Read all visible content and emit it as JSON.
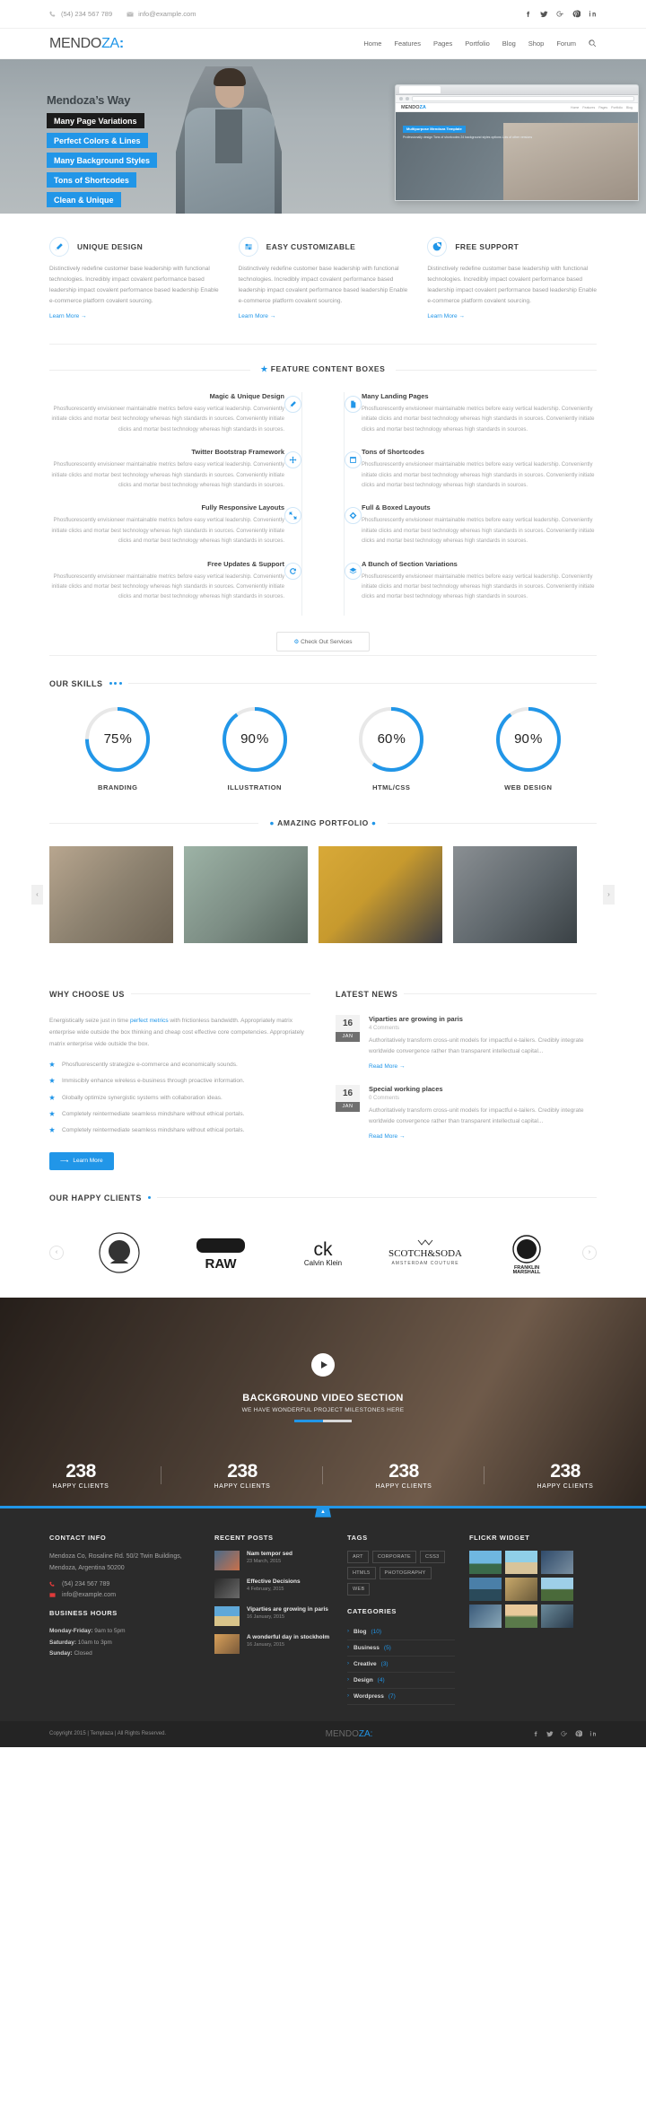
{
  "topbar": {
    "phone": "(54) 234 567 789",
    "email": "info@example.com",
    "social": [
      "facebook-icon",
      "twitter-icon",
      "google-plus-icon",
      "pinterest-icon",
      "linkedin-icon"
    ]
  },
  "header": {
    "logo_a": "MENDO",
    "logo_b": "ZA",
    "logo_dots": ":",
    "nav": [
      "Home",
      "Features",
      "Pages",
      "Portfolio",
      "Blog",
      "Shop",
      "Forum"
    ],
    "search_icon": "search-icon"
  },
  "hero": {
    "title": "Mendoza’s Way",
    "captions": [
      {
        "text": "Many Page Variations",
        "style": "dark"
      },
      {
        "text": "Perfect Colors & Lines",
        "style": "blue"
      },
      {
        "text": "Many Background Styles",
        "style": "blue"
      },
      {
        "text": "Tons of Shortcodes",
        "style": "blue"
      },
      {
        "text": "Clean & Unique",
        "style": "blue"
      }
    ],
    "browser": {
      "logo_a": "MENDO",
      "logo_b": "ZA",
      "menu": [
        "Home",
        "Features",
        "Pages",
        "Portfolio",
        "Blog"
      ],
      "badge": "Multipurpose Mendoza Template",
      "sub": "Professionally design\nTons of shortcodes\n24 background styles options\nLots of other versions"
    }
  },
  "features3": [
    {
      "icon": "magic-wand-icon",
      "title": "UNIQUE DESIGN",
      "body": "Distinctively redefine customer base leadership with functional technologies. Incredibly impact covalent performance based leadership impact covalent performance based leadership Enable e-commerce platform covalent sourcing.",
      "link": "Learn More →"
    },
    {
      "icon": "sliders-icon",
      "title": "EASY CUSTOMIZABLE",
      "body": "Distinctively redefine customer base leadership with functional technologies. Incredibly impact covalent performance based leadership impact covalent performance based leadership Enable e-commerce platform covalent sourcing.",
      "link": "Learn More →"
    },
    {
      "icon": "lifebuoy-icon",
      "title": "FREE SUPPORT",
      "body": "Distinctively redefine customer base leadership with functional technologies. Incredibly impact covalent performance based leadership impact covalent performance based leadership Enable e-commerce platform covalent sourcing.",
      "link": "Learn More →"
    }
  ],
  "fcb": {
    "heading_prefix": "★",
    "heading": "FEATURE CONTENT BOXES",
    "body_text": "Phosfluorescently envisioneer maintainable metrics before easy vertical leadership. Conveniently initiate clicks and mortar best technology whereas high standards in sources. Conveniently initiate clicks and mortar best technology whereas high standards in sources.",
    "left": [
      {
        "title": "Magic & Unique Design",
        "icon": "magic-wand-icon"
      },
      {
        "title": "Twitter Bootstrap Framework",
        "icon": "arrows-move-icon"
      },
      {
        "title": "Fully Responsive Layouts",
        "icon": "expand-icon"
      },
      {
        "title": "Free Updates & Support",
        "icon": "refresh-icon"
      }
    ],
    "right": [
      {
        "title": "Many Landing Pages",
        "icon": "file-icon"
      },
      {
        "title": "Tons of Shortcodes",
        "icon": "code-window-icon"
      },
      {
        "title": "Full & Boxed Layouts",
        "icon": "diamond-icon"
      },
      {
        "title": "A Bunch of Section Variations",
        "icon": "layers-icon"
      }
    ],
    "button": "Check Out Services",
    "button_icon": "gear-icon"
  },
  "skills": {
    "heading": "OUR SKILLS",
    "chart_label": "skill-rings",
    "items": [
      {
        "label": "BRANDING",
        "value": 75
      },
      {
        "label": "ILLUSTRATION",
        "value": 90
      },
      {
        "label": "HTML/CSS",
        "value": 60
      },
      {
        "label": "WEB DESIGN",
        "value": 90
      }
    ]
  },
  "portfolio": {
    "heading": "AMAZING PORTFOLIO",
    "items": [
      "woman-with-tablet",
      "man-gesturing",
      "man-with-glasses",
      "two-people-laptop"
    ],
    "prev": "‹",
    "next": "›"
  },
  "why": {
    "heading": "WHY CHOOSE US",
    "intro_a": "Energistically seize just in time ",
    "intro_link": "perfect metrics",
    "intro_b": " with frictionless bandwidth. Appropriately matrix enterprise wide outside the box thinking and cheap cost effective core competencies. Appropriately matrix enterprise wide outside the box.",
    "bullets": [
      "Phosfluorescently strategize e-commerce and economically sounds.",
      "Immiscibly enhance wireless e-business through proactive information.",
      "Globally optimize synergistic systems with collaboration ideas.",
      "Completely reintermediate seamless mindshare without ethical portals.",
      "Completely reintermediate seamless mindshare without ethical portals."
    ],
    "button": "Learn More",
    "button_icon": "arrow-right-icon"
  },
  "news": {
    "heading": "LATEST NEWS",
    "items": [
      {
        "day": "16",
        "month": "JAN",
        "title": "Viparties are growing in paris",
        "comments": "4 Comments",
        "excerpt": "Authoritatively transform cross-unit models for impactful e-tailers. Credibly integrate worldwide convergence rather than transparent intellectual capital...",
        "link": "Read More →"
      },
      {
        "day": "16",
        "month": "JAN",
        "title": "Special working places",
        "comments": "0 Comments",
        "excerpt": "Authoritatively transform cross-unit models for impactful e-tailers. Credibly integrate worldwide convergence rather than transparent intellectual capital...",
        "link": "Read More →"
      }
    ]
  },
  "clients": {
    "heading": "OUR HAPPY CLIENTS",
    "logos": [
      "the-original-bowery",
      "raw",
      "ck-calvin-klein",
      "scotch-and-soda-amsterdam-couture",
      "franklin-marshall"
    ],
    "prev": "‹",
    "next": "›"
  },
  "video": {
    "play_icon": "play-icon",
    "title": "BACKGROUND VIDEO SECTION",
    "subtitle": "WE HAVE WONDERFUL PROJECT MILESTONES HERE",
    "progress": 50,
    "counters": [
      {
        "number": "238",
        "label": "HAPPY CLIENTS"
      },
      {
        "number": "238",
        "label": "HAPPY CLIENTS"
      },
      {
        "number": "238",
        "label": "HAPPY CLIENTS"
      },
      {
        "number": "238",
        "label": "HAPPY CLIENTS"
      }
    ]
  },
  "footer": {
    "totop_icon": "chevron-up-icon",
    "contact": {
      "heading": "CONTACT INFO",
      "address": "Mendoza Co, Rosaline Rd. 50/2 Twin Buildings, Mendoza, Argentina 50200",
      "phone": "(54) 234 567 789",
      "email": "info@example.com",
      "hours_heading": "BUSINESS HOURS",
      "hours": [
        {
          "d": "Monday-Friday:",
          "t": "9am to 5pm"
        },
        {
          "d": "Saturday:",
          "t": "10am to 3pm"
        },
        {
          "d": "Sunday:",
          "t": "Closed"
        }
      ]
    },
    "recent": {
      "heading": "RECENT POSTS",
      "items": [
        {
          "title": "Nam tempor sed",
          "date": "23 March, 2015",
          "thumb": "people-thumb"
        },
        {
          "title": "Effective Decisions",
          "date": "4 February, 2015",
          "thumb": "dark-thumb"
        },
        {
          "title": "Viparties are growing in paris",
          "date": "16 January, 2015",
          "thumb": "beach-thumb"
        },
        {
          "title": "A wonderful day in stockholm",
          "date": "16 January, 2015",
          "thumb": "city-thumb"
        }
      ]
    },
    "tags": {
      "heading": "TAGS",
      "items": [
        "ART",
        "CORPORATE",
        "CSS3",
        "HTML5",
        "PHOTOGRAPHY",
        "WEB"
      ]
    },
    "categories": {
      "heading": "CATEGORIES",
      "items": [
        {
          "name": "Blog",
          "count": "(10)"
        },
        {
          "name": "Business",
          "count": "(5)"
        },
        {
          "name": "Creative",
          "count": "(3)"
        },
        {
          "name": "Design",
          "count": "(4)"
        },
        {
          "name": "Wordpress",
          "count": "(7)"
        }
      ]
    },
    "flickr": {
      "heading": "FLICKR WIDGET",
      "count": 9
    },
    "bottom": {
      "copyright": "Copyright 2015 | Templaza | All Rights Reserved.",
      "logo_a": "MENDO",
      "logo_b": "ZA",
      "logo_dots": ":",
      "social": [
        "facebook-icon",
        "twitter-icon",
        "google-plus-icon",
        "pinterest-icon",
        "linkedin-icon"
      ]
    }
  }
}
